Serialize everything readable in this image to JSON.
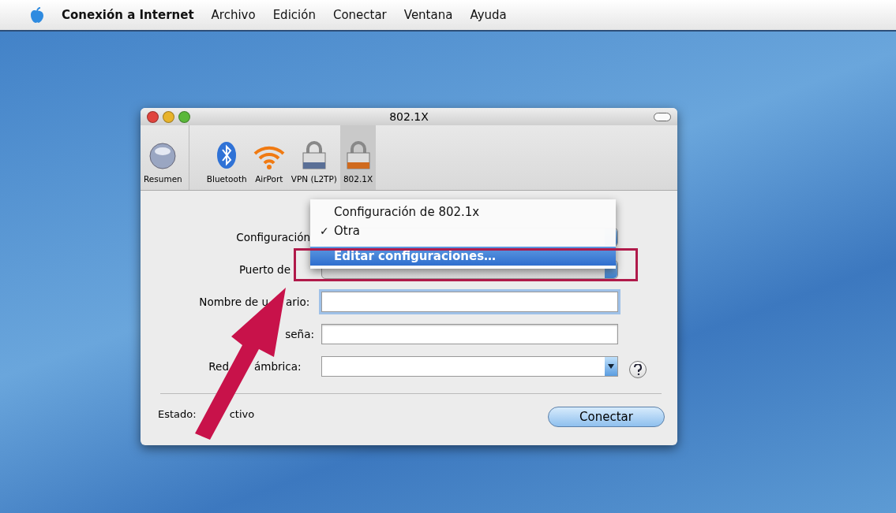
{
  "menubar": {
    "app_name": "Conexión a Internet",
    "items": [
      "Archivo",
      "Edición",
      "Conectar",
      "Ventana",
      "Ayuda"
    ]
  },
  "window": {
    "title": "802.1X",
    "toolbar": [
      {
        "label": "Resumen",
        "selected": false
      },
      {
        "label": "Bluetooth",
        "selected": false
      },
      {
        "label": "AirPort",
        "selected": false
      },
      {
        "label": "VPN (L2TP)",
        "selected": false
      },
      {
        "label": "802.1X",
        "selected": true
      }
    ],
    "rows": [
      {
        "kind": "popup",
        "label_parts": [
          "Configuración"
        ]
      },
      {
        "kind": "popup",
        "label_parts": [
          "Puerto de"
        ]
      },
      {
        "kind": "text",
        "label_parts": [
          "Nombre de u",
          "ario:"
        ],
        "focused": true
      },
      {
        "kind": "text",
        "label_parts": [
          "seña:"
        ],
        "focused": false
      },
      {
        "kind": "combo",
        "label_parts": [
          "Red",
          "ámbrica:"
        ],
        "help": true
      }
    ],
    "status_parts": [
      "Estado:",
      "ctivo"
    ],
    "button": "Conectar"
  },
  "menu": {
    "check_mark": "✓",
    "items": [
      {
        "kind": "item",
        "label": "Configuración de 802.1x",
        "checked": false,
        "selected": false
      },
      {
        "kind": "item",
        "label": "Otra",
        "checked": true,
        "selected": false
      },
      {
        "kind": "separator"
      },
      {
        "kind": "item",
        "label": "Editar configuraciones…",
        "checked": false,
        "selected": true
      }
    ]
  }
}
